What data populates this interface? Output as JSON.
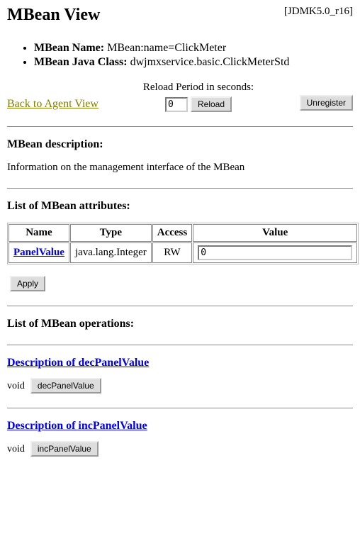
{
  "header": {
    "title": "MBean View",
    "version": "[JDMK5.0_r16]"
  },
  "mbean": {
    "name_label": "MBean Name:",
    "name_value": "MBean:name=ClickMeter",
    "class_label": "MBean Java Class:",
    "class_value": "dwjmxservice.basic.ClickMeterStd"
  },
  "controls": {
    "back_link": "Back to Agent View",
    "reload_label": "Reload Period in seconds:",
    "reload_value": "0",
    "reload_button": "Reload",
    "unregister_button": "Unregister"
  },
  "description": {
    "heading": "MBean description:",
    "text": "Information on the management interface of the MBean"
  },
  "attributes": {
    "heading": "List of MBean attributes:",
    "columns": {
      "name": "Name",
      "type": "Type",
      "access": "Access",
      "value": "Value"
    },
    "rows": [
      {
        "name": "PanelValue",
        "type": "java.lang.Integer",
        "access": "RW",
        "value": "0"
      }
    ],
    "apply_button": "Apply"
  },
  "operations": {
    "heading": "List of MBean operations:",
    "items": [
      {
        "desc_label": "Description of decPanelValue",
        "return_type": "void",
        "op_name": "decPanelValue"
      },
      {
        "desc_label": "Description of incPanelValue",
        "return_type": "void",
        "op_name": "incPanelValue"
      }
    ]
  }
}
